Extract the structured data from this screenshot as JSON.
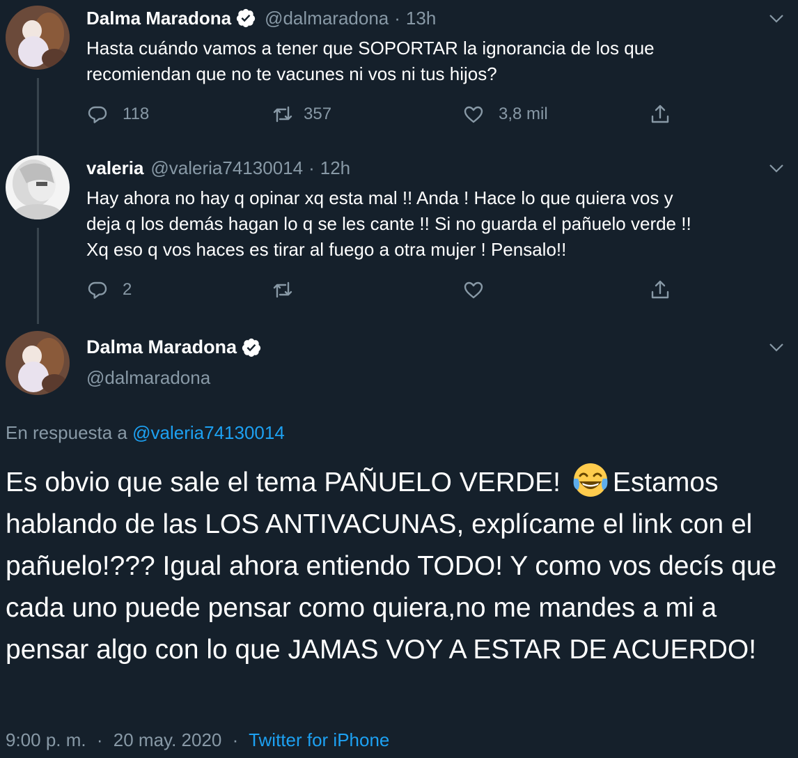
{
  "tweets": [
    {
      "name": "Dalma Maradona",
      "handle": "@dalmaradona",
      "time": "13h",
      "text": "Hasta cuándo vamos a tener que SOPORTAR la ignorancia de los que\nrecomiendan que no te vacunes ni vos ni tus hijos?",
      "replies": "118",
      "retweets": "357",
      "likes": "3,8 mil"
    },
    {
      "name": "valeria",
      "handle": "@valeria74130014",
      "time": "12h",
      "text": "Hay ahora no hay q opinar xq esta mal !! Anda !  Hace lo que quiera vos y\ndeja q los demás hagan lo q se les cante !! Si no guarda el pañuelo verde !!\nXq eso q vos haces es tirar al fuego a otra mujer ! Pensalo!!",
      "replies": "2",
      "retweets": "",
      "likes": ""
    }
  ],
  "main": {
    "name": "Dalma Maradona",
    "handle": "@dalmaradona",
    "reply_prefix": "En respuesta a ",
    "reply_mention": "@valeria74130014",
    "text_before_emoji": "Es obvio que sale el tema PAÑUELO VERDE! ",
    "emoji": "face-with-tears-of-joy",
    "text_after_emoji": "Estamos hablando de las LOS ANTIVACUNAS, explícame el link con el pañuelo!??? Igual ahora entiendo TODO! Y como vos decís que cada uno puede pensar como quiera,no me mandes a mi a pensar algo con lo que JAMAS VOY A ESTAR DE ACUERDO!",
    "time": "9:00 p. m.",
    "date": "20 may. 2020",
    "source": "Twitter for iPhone"
  },
  "dot": "·",
  "colors": {
    "background": "#15202b",
    "secondary_text": "#8899a6",
    "link": "#1da1f2",
    "thread_line": "#38444d"
  },
  "icons": [
    "verified-badge-icon",
    "chevron-down-icon",
    "reply-icon",
    "retweet-icon",
    "like-icon",
    "share-icon"
  ]
}
